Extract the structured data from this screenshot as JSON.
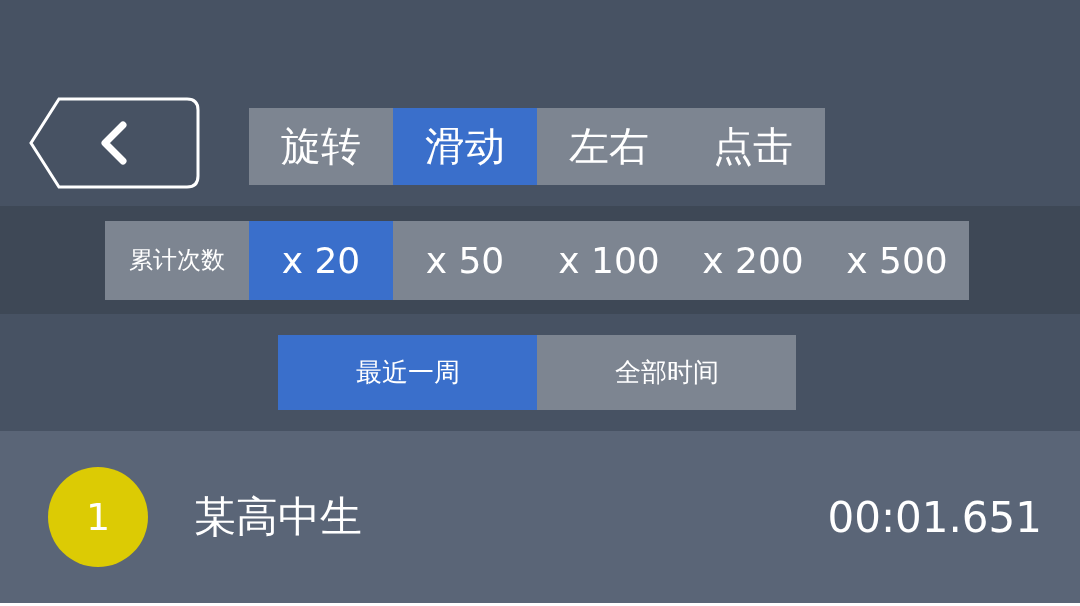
{
  "modes": [
    {
      "label": "旋转",
      "selected": false
    },
    {
      "label": "滑动",
      "selected": true
    },
    {
      "label": "左右",
      "selected": false
    },
    {
      "label": "点击",
      "selected": false
    }
  ],
  "count_filter": {
    "label": "累计次数",
    "options": [
      {
        "label": "x 20",
        "selected": true
      },
      {
        "label": "x 50",
        "selected": false
      },
      {
        "label": "x 100",
        "selected": false
      },
      {
        "label": "x 200",
        "selected": false
      },
      {
        "label": "x 500",
        "selected": false
      }
    ]
  },
  "time_filter": [
    {
      "label": "最近一周",
      "selected": true
    },
    {
      "label": "全部时间",
      "selected": false
    }
  ],
  "leaderboard": [
    {
      "rank": "1",
      "color": "#dccb04",
      "name": "某高中生",
      "time": "00:01.651"
    }
  ]
}
